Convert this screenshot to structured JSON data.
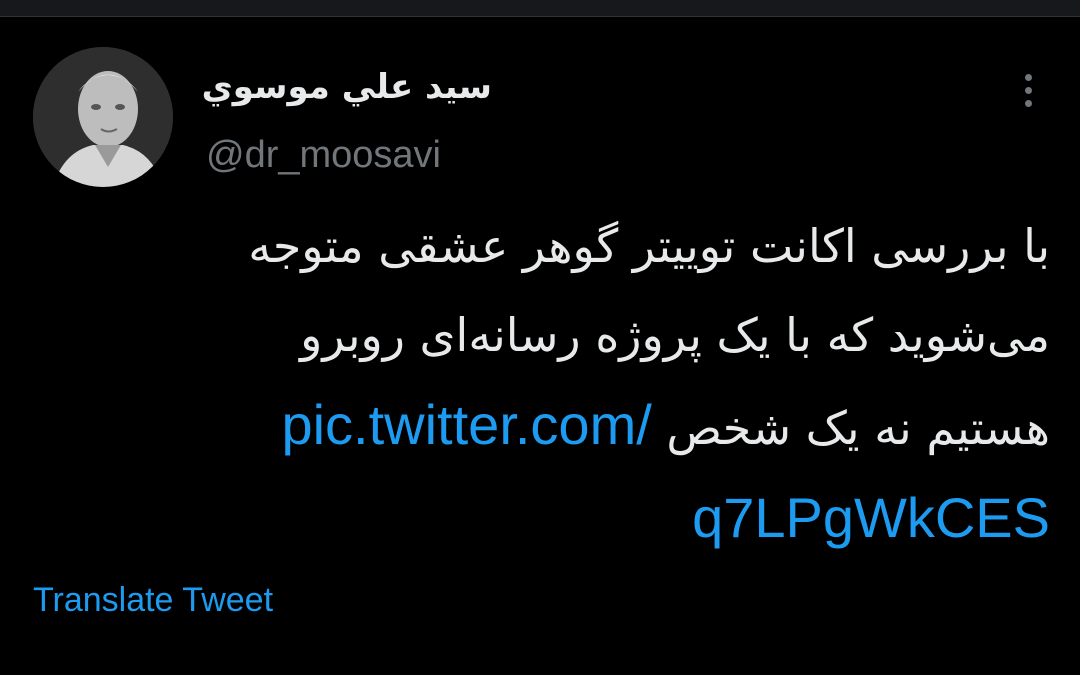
{
  "author": {
    "display_name": "سيد علي موسوي",
    "handle": "@dr_moosavi"
  },
  "tweet": {
    "line1": "با بررسی اکانت توییتر گوهر عشقی متوجه",
    "line2": "می‌شوید که با یک پروژه رسانه‌ای روبرو",
    "line3": "هستیم نه یک شخص",
    "link_part1": "pic.twitter.com/",
    "link_part2": "q7LPgWkCES"
  },
  "actions": {
    "translate_label": "Translate Tweet",
    "more_icon": "more-vertical-icon"
  },
  "colors": {
    "background": "#000000",
    "text": "#e7e9ea",
    "secondary_text": "#71767b",
    "link": "#1d9bf0"
  }
}
